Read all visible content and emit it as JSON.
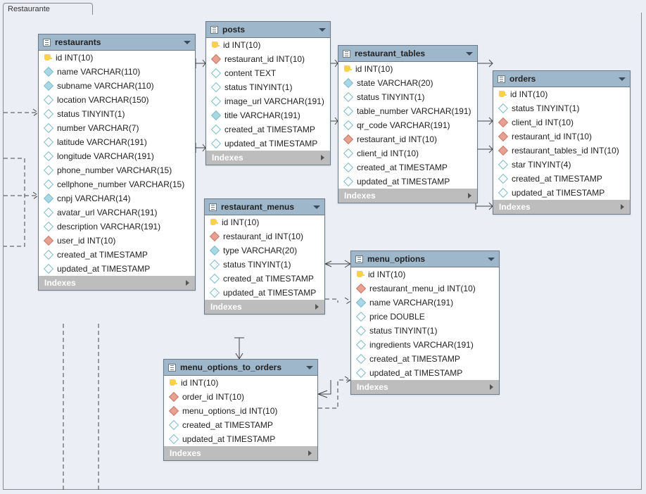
{
  "schema_name": "Restaurante",
  "indexes_label": "Indexes",
  "tables": {
    "restaurants": {
      "name": "restaurants",
      "columns": [
        {
          "kind": "pk",
          "label": "id INT(10)"
        },
        {
          "kind": "col-f",
          "label": "name VARCHAR(110)"
        },
        {
          "kind": "col-f",
          "label": "subname VARCHAR(110)"
        },
        {
          "kind": "col",
          "label": "location VARCHAR(150)"
        },
        {
          "kind": "col",
          "label": "status TINYINT(1)"
        },
        {
          "kind": "col",
          "label": "number VARCHAR(7)"
        },
        {
          "kind": "col",
          "label": "latitude VARCHAR(191)"
        },
        {
          "kind": "col",
          "label": "longitude VARCHAR(191)"
        },
        {
          "kind": "col",
          "label": "phone_number VARCHAR(15)"
        },
        {
          "kind": "col",
          "label": "cellphone_number VARCHAR(15)"
        },
        {
          "kind": "col-f",
          "label": "cnpj VARCHAR(14)"
        },
        {
          "kind": "col",
          "label": "avatar_url VARCHAR(191)"
        },
        {
          "kind": "col",
          "label": "description VARCHAR(191)"
        },
        {
          "kind": "fk",
          "label": "user_id INT(10)"
        },
        {
          "kind": "col",
          "label": "created_at TIMESTAMP"
        },
        {
          "kind": "col",
          "label": "updated_at TIMESTAMP"
        }
      ]
    },
    "posts": {
      "name": "posts",
      "columns": [
        {
          "kind": "pk",
          "label": "id INT(10)"
        },
        {
          "kind": "fk",
          "label": "restaurant_id INT(10)"
        },
        {
          "kind": "col",
          "label": "content TEXT"
        },
        {
          "kind": "col",
          "label": "status TINYINT(1)"
        },
        {
          "kind": "col",
          "label": "image_url VARCHAR(191)"
        },
        {
          "kind": "col-f",
          "label": "title VARCHAR(191)"
        },
        {
          "kind": "col",
          "label": "created_at TIMESTAMP"
        },
        {
          "kind": "col",
          "label": "updated_at TIMESTAMP"
        }
      ]
    },
    "restaurant_menus": {
      "name": "restaurant_menus",
      "columns": [
        {
          "kind": "pk",
          "label": "id INT(10)"
        },
        {
          "kind": "fk",
          "label": "restaurant_id INT(10)"
        },
        {
          "kind": "col-f",
          "label": "type VARCHAR(20)"
        },
        {
          "kind": "col",
          "label": "status TINYINT(1)"
        },
        {
          "kind": "col",
          "label": "created_at TIMESTAMP"
        },
        {
          "kind": "col",
          "label": "updated_at TIMESTAMP"
        }
      ]
    },
    "menu_options_to_orders": {
      "name": "menu_options_to_orders",
      "columns": [
        {
          "kind": "pk",
          "label": "id INT(10)"
        },
        {
          "kind": "fk",
          "label": "order_id INT(10)"
        },
        {
          "kind": "fk",
          "label": "menu_options_id INT(10)"
        },
        {
          "kind": "col",
          "label": "created_at TIMESTAMP"
        },
        {
          "kind": "col",
          "label": "updated_at TIMESTAMP"
        }
      ]
    },
    "restaurant_tables": {
      "name": "restaurant_tables",
      "columns": [
        {
          "kind": "pk",
          "label": "id INT(10)"
        },
        {
          "kind": "col-f",
          "label": "state VARCHAR(20)"
        },
        {
          "kind": "col",
          "label": "status TINYINT(1)"
        },
        {
          "kind": "col",
          "label": "table_number VARCHAR(191)"
        },
        {
          "kind": "col",
          "label": "qr_code VARCHAR(191)"
        },
        {
          "kind": "fk",
          "label": "restaurant_id INT(10)"
        },
        {
          "kind": "col",
          "label": "client_id INT(10)"
        },
        {
          "kind": "col",
          "label": "created_at TIMESTAMP"
        },
        {
          "kind": "col",
          "label": "updated_at TIMESTAMP"
        }
      ]
    },
    "menu_options": {
      "name": "menu_options",
      "columns": [
        {
          "kind": "pk",
          "label": "id INT(10)"
        },
        {
          "kind": "fk",
          "label": "restaurant_menu_id INT(10)"
        },
        {
          "kind": "col-f",
          "label": "name VARCHAR(191)"
        },
        {
          "kind": "col",
          "label": "price DOUBLE"
        },
        {
          "kind": "col",
          "label": "status TINYINT(1)"
        },
        {
          "kind": "col",
          "label": "ingredients VARCHAR(191)"
        },
        {
          "kind": "col",
          "label": "created_at TIMESTAMP"
        },
        {
          "kind": "col",
          "label": "updated_at TIMESTAMP"
        }
      ]
    },
    "orders": {
      "name": "orders",
      "columns": [
        {
          "kind": "pk",
          "label": "id INT(10)"
        },
        {
          "kind": "col",
          "label": "status TINYINT(1)"
        },
        {
          "kind": "fk",
          "label": "client_id INT(10)"
        },
        {
          "kind": "fk",
          "label": "restaurant_id INT(10)"
        },
        {
          "kind": "fk",
          "label": "restaurant_tables_id INT(10)"
        },
        {
          "kind": "col",
          "label": "star TINYINT(4)"
        },
        {
          "kind": "col",
          "label": "created_at TIMESTAMP"
        },
        {
          "kind": "col",
          "label": "updated_at TIMESTAMP"
        }
      ]
    }
  }
}
